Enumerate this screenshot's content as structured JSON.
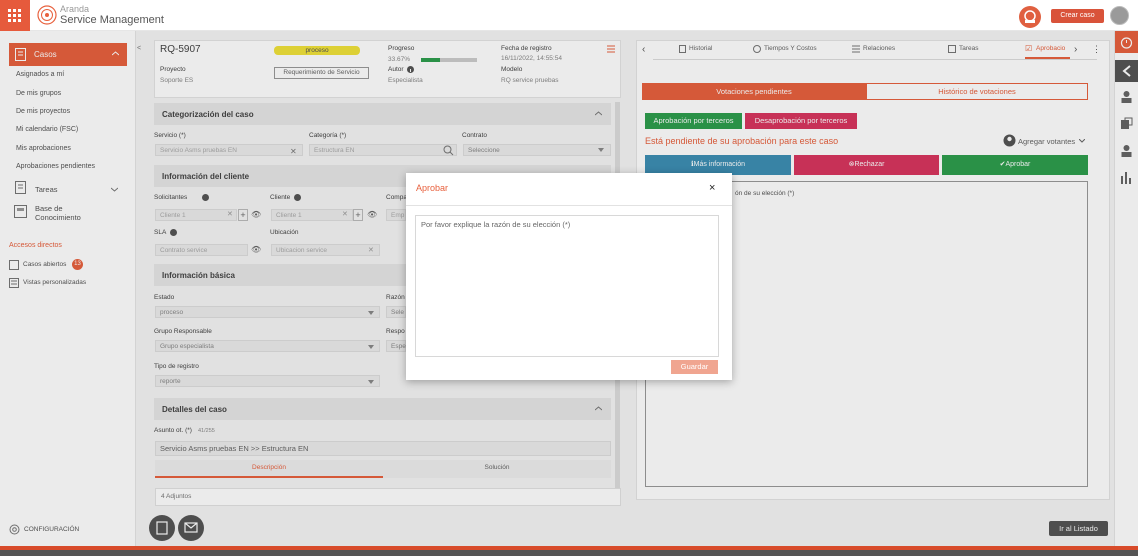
{
  "app": {
    "brand_line1": "Aranda",
    "brand_line2": "Service Management",
    "create_button": "Crear caso"
  },
  "sidebar": {
    "section": "Casos",
    "items": [
      "Asignados a mí",
      "De mis grupos",
      "De mis proyectos",
      "Mi calendario (FSC)",
      "Mis aprobaciones",
      "Aprobaciones pendientes"
    ],
    "tareas": "Tareas",
    "kb_line1": "Base de",
    "kb_line2": "Conocimiento",
    "shortcuts_title": "Accesos directos",
    "open_cases": "Casos abiertos",
    "open_cases_count": "13",
    "custom_views": "Vistas personalizadas",
    "config": "CONFIGURACIÓN"
  },
  "case": {
    "id": "RQ-5907",
    "status_badge": "proceso",
    "progress_label": "Progreso",
    "progress_value": "33.67%",
    "progress_fraction": 0.3367,
    "author_label": "Autor",
    "author_value": "Especialista",
    "date_label": "Fecha de registro",
    "date_value": "16/11/2022, 14:55:54",
    "model_label": "Modelo",
    "model_value": "RQ service pruebas",
    "project_label": "Proyecto",
    "project_value": "Soporte ES",
    "type_button": "Requerimiento de Servicio"
  },
  "form": {
    "cat_title": "Categorización del caso",
    "service_label": "Servicio (*)",
    "service_value": "Servicio Asms pruebas EN",
    "category_label": "Categoría (*)",
    "category_value": "Estructura EN",
    "contract_label": "Contrato",
    "contract_value": "Seleccione",
    "client_title": "Información del cliente",
    "requesters_label": "Solicitantes",
    "requesters_value": "Cliente 1",
    "client_label": "Cliente",
    "client_value": "Cliente 1",
    "company_label": "Compa",
    "company_value": "Emp",
    "sla_label": "SLA",
    "sla_value": "Contrato service",
    "location_label": "Ubicación",
    "location_value": "Ubicacion service",
    "basic_title": "Información básica",
    "state_label": "Estado",
    "state_value": "proceso",
    "reason_label": "Razón",
    "reason_value": "Sele",
    "group_label": "Grupo Responsable",
    "group_value": "Grupo especialista",
    "resp_label": "Respo",
    "resp_value": "Espe",
    "regtype_label": "Tipo de registro",
    "regtype_value": "reporte",
    "details_title": "Detalles del caso",
    "subject_label": "Asunto ot. (*)",
    "subject_count": "41/255",
    "subject_value": "Servicio Asms pruebas EN >> Estructura EN",
    "tab_description": "Descripción",
    "tab_solution": "Solución",
    "attachments": "4 Adjuntos"
  },
  "right": {
    "tabs": [
      "Historial",
      "Tiempos Y Costos",
      "Relaciones",
      "Tareas",
      "Aprobacio"
    ],
    "subtab_pending": "Votaciones pendientes",
    "subtab_history": "Histórico de votaciones",
    "approve_third": "Aprobación por terceros",
    "disapprove_third": "Desaprobación por terceros",
    "pending_msg": "Está pendiente de su aprobación para este caso",
    "add_voters": "Agregar votantes",
    "more_info": "Más información",
    "reject": "Rechazar",
    "approve": "Aprobar",
    "reason_hint": "ón de su elección (*)"
  },
  "modal": {
    "title": "Aprobar",
    "placeholder": "Por favor explique la razón de su elección (*)",
    "save": "Guardar"
  },
  "footer": {
    "back": "Ir al Listado"
  },
  "colors": {
    "accent": "#e8613e",
    "green": "#2e9e4e",
    "red": "#d8365f",
    "blue": "#3d8fb4"
  }
}
